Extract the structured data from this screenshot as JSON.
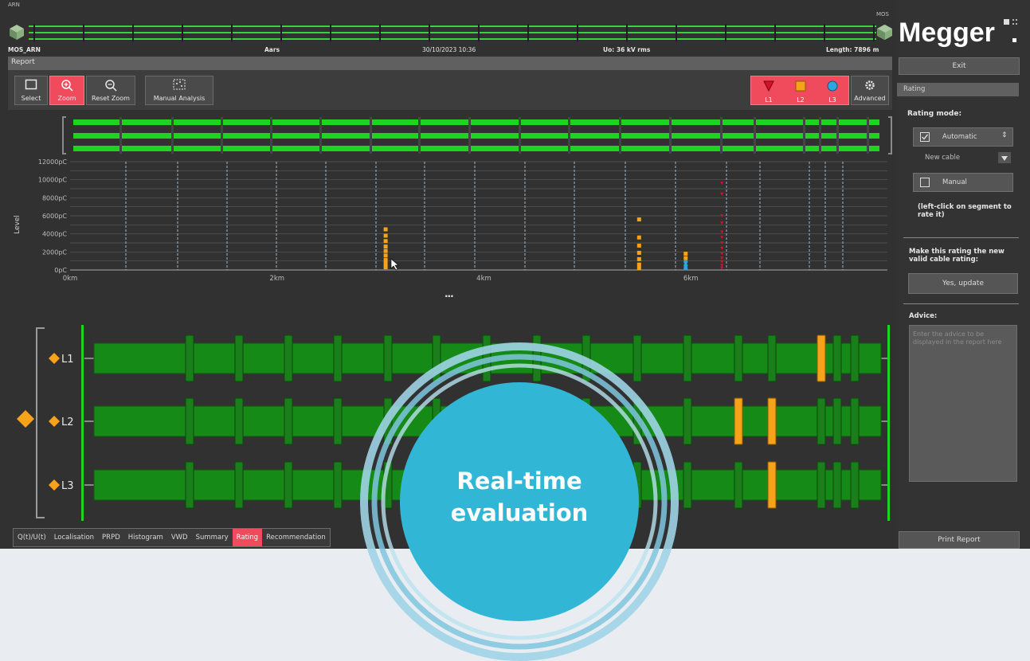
{
  "top_bar": {
    "left_station_code": "ARN",
    "right_station_code": "MOS",
    "left_station_name": "MOS_ARN",
    "location": "Aars",
    "datetime": "30/10/2023 10:36",
    "voltage": "Uo: 36 kV rms",
    "length": "Length: 7896 m"
  },
  "brand": {
    "logo_text": "Megger",
    "accent_color": "#f04a5d"
  },
  "report": {
    "title": "Report"
  },
  "toolbar": {
    "select_label": "Select",
    "zoom_label": "Zoom",
    "reset_zoom_label": "Reset Zoom",
    "manual_analysis_label": "Manual Analysis",
    "advanced_label": "Advanced",
    "phases": [
      {
        "label": "L1",
        "icon": "triangle-down-icon",
        "color": "#d8102a"
      },
      {
        "label": "L2",
        "icon": "square-icon",
        "color": "#f6a21a"
      },
      {
        "label": "L3",
        "icon": "circle-icon",
        "color": "#2aa7e0"
      }
    ]
  },
  "chart_data": {
    "type": "scatter",
    "ylabel": "Level",
    "yticks": [
      "12000pC",
      "10000pC",
      "8000pC",
      "6000pC",
      "4000pC",
      "2000pC",
      "0pC"
    ],
    "xticks": [
      "0km",
      "2km",
      "4km",
      "6km"
    ],
    "xlim": [
      0,
      7.9
    ],
    "ylim": [
      0,
      12000
    ],
    "series": [
      {
        "name": "L1",
        "color": "#d8102a",
        "points": [
          [
            6.3,
            9600
          ],
          [
            6.3,
            8400
          ],
          [
            6.3,
            6000
          ],
          [
            6.3,
            5200
          ],
          [
            6.3,
            4200
          ],
          [
            6.3,
            3600
          ],
          [
            6.3,
            3000
          ],
          [
            6.3,
            2400
          ],
          [
            6.3,
            1800
          ],
          [
            6.3,
            1300
          ],
          [
            6.3,
            900
          ],
          [
            6.3,
            500
          ],
          [
            6.3,
            200
          ]
        ]
      },
      {
        "name": "L2",
        "color": "#f6a21a",
        "points": [
          [
            3.05,
            4500
          ],
          [
            3.05,
            3800
          ],
          [
            3.05,
            3200
          ],
          [
            3.05,
            2600
          ],
          [
            3.05,
            2100
          ],
          [
            3.05,
            1600
          ],
          [
            3.05,
            1100
          ],
          [
            3.05,
            700
          ],
          [
            3.05,
            300
          ],
          [
            5.5,
            5600
          ],
          [
            5.5,
            3600
          ],
          [
            5.5,
            2700
          ],
          [
            5.5,
            1900
          ],
          [
            5.5,
            1200
          ],
          [
            5.5,
            600
          ],
          [
            5.5,
            200
          ],
          [
            5.95,
            1800
          ],
          [
            5.95,
            1300
          ]
        ]
      },
      {
        "name": "L3",
        "color": "#2aa7e0",
        "points": [
          [
            5.95,
            900
          ],
          [
            5.95,
            500
          ],
          [
            5.95,
            200
          ]
        ]
      }
    ]
  },
  "overview_dots": "...",
  "phases_view": {
    "rows": [
      {
        "label": "L1",
        "rating_color": "#f6a21a",
        "hot_joints": [
          13
        ]
      },
      {
        "label": "L2",
        "rating_color": "#f6a21a",
        "hot_joints": [
          6,
          11,
          12
        ]
      },
      {
        "label": "L3",
        "rating_color": "#f6a21a",
        "hot_joints": [
          12
        ]
      }
    ],
    "overall_color": "#f6a21a"
  },
  "tabs": [
    {
      "label": "Q(t)/U(t)",
      "active": false
    },
    {
      "label": "Localisation",
      "active": false
    },
    {
      "label": "PRPD",
      "active": false
    },
    {
      "label": "Histogram",
      "active": false
    },
    {
      "label": "VWD",
      "active": false
    },
    {
      "label": "Summary",
      "active": false
    },
    {
      "label": "Rating",
      "active": true
    },
    {
      "label": "Recommendation",
      "active": false
    }
  ],
  "right_panel": {
    "exit_label": "Exit",
    "section_title": "Rating",
    "rating_mode_label": "Rating mode:",
    "automatic_label": "Automatic",
    "automatic_checked": true,
    "cable_type": "New cable",
    "manual_label": "Manual",
    "manual_checked": false,
    "manual_hint": "(left-click on segment to rate it)",
    "update_prompt": "Make this rating the new valid cable rating:",
    "update_button": "Yes, update",
    "advice_label": "Advice:",
    "advice_placeholder": "Enter the advice to be displayed in the report here",
    "print_label": "Print Report"
  },
  "badge": {
    "line1": "Real-time",
    "line2": "evaluation",
    "color": "#31b6d6"
  }
}
